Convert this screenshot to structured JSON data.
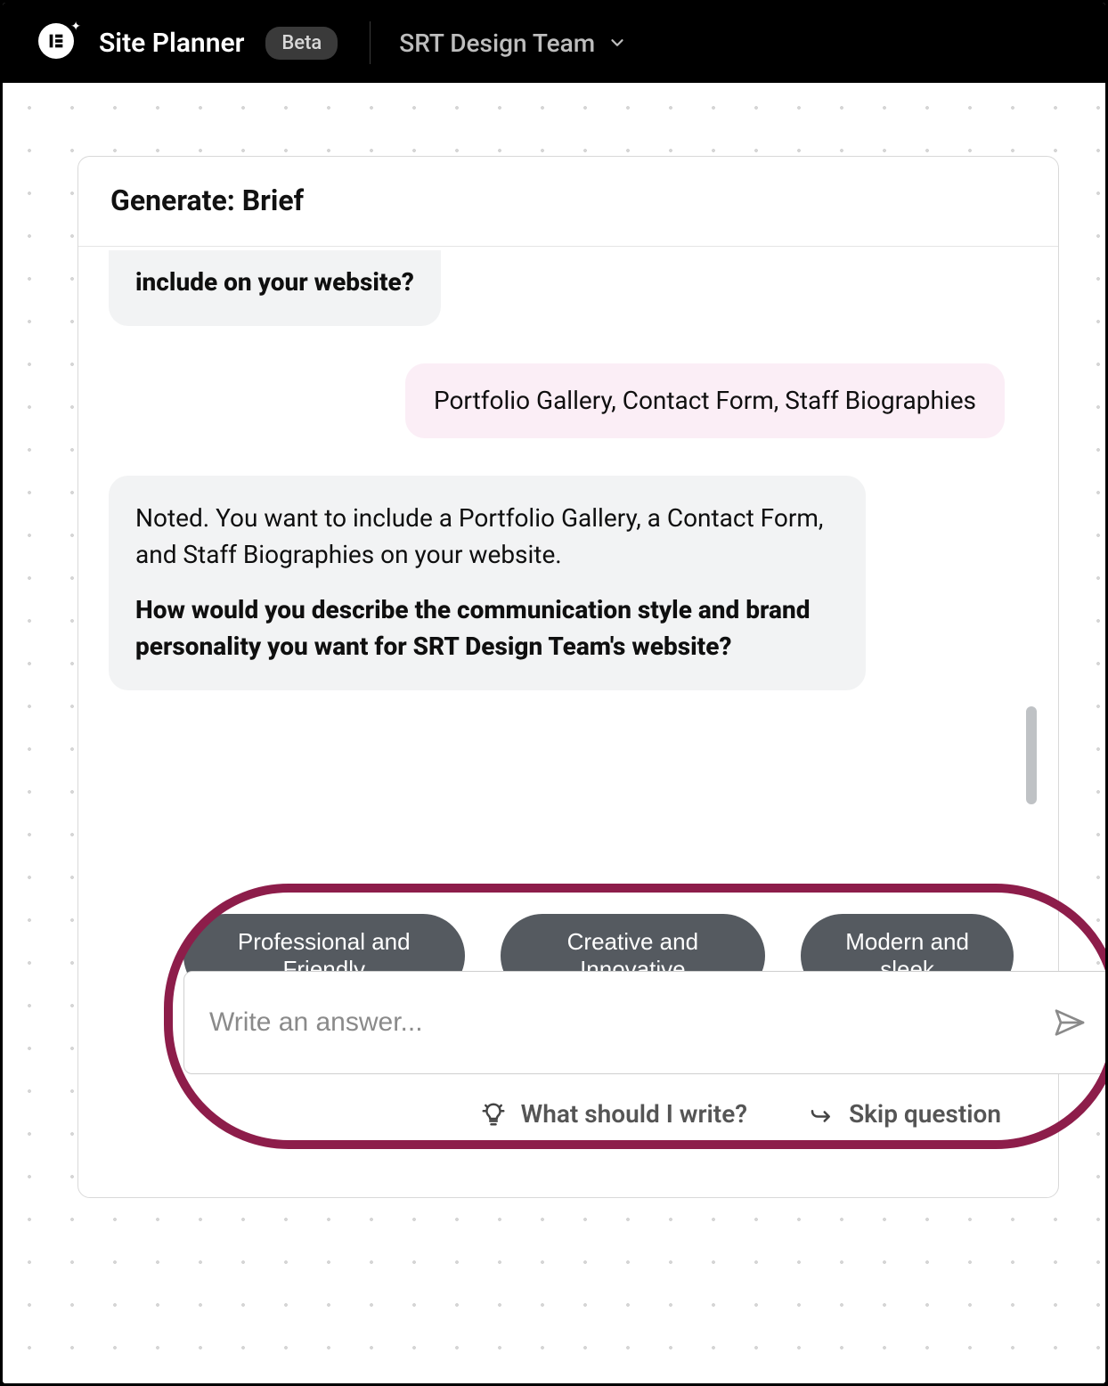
{
  "header": {
    "app_title": "Site Planner",
    "badge": "Beta",
    "workspace_name": "SRT Design Team"
  },
  "panel": {
    "title": "Generate: Brief"
  },
  "chat": {
    "msg0_question_fragment": "include on your website?",
    "msg1_user": "Portfolio Gallery, Contact Form, Staff Biographies",
    "msg2_intro": "Noted. You want to include a Portfolio Gallery, a Contact Form, and Staff Biographies on your website.",
    "msg2_question": "How would you describe the communication style and brand personality you want for SRT Design Team's website?"
  },
  "suggestions": {
    "chip1": "Professional and Friendly",
    "chip2": "Creative and Innovative",
    "chip3": "Modern and sleek"
  },
  "input": {
    "placeholder": "Write an answer..."
  },
  "helpers": {
    "hint": "What should I write?",
    "skip": "Skip question"
  }
}
